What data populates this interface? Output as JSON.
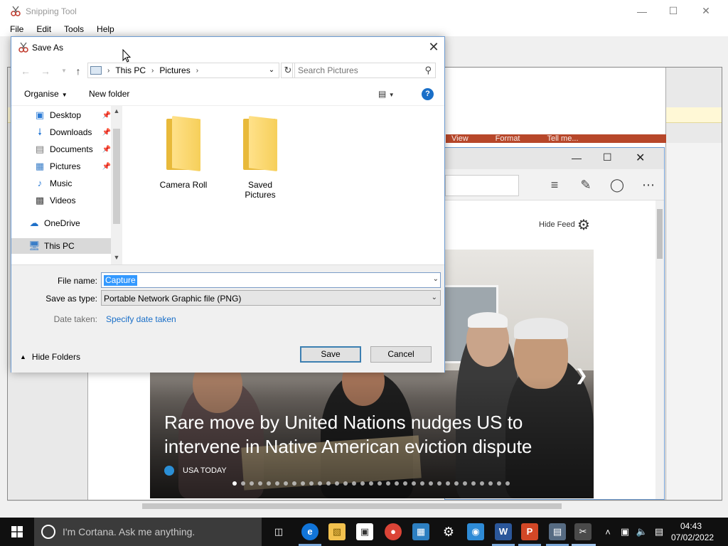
{
  "snipping_tool": {
    "title": "Snipping Tool",
    "menu": [
      "File",
      "Edit",
      "Tools",
      "Help"
    ]
  },
  "captured": {
    "ppt_tabs": [
      "View",
      "Format",
      "Tell me..."
    ],
    "edge": {
      "hide_feed": "Hide Feed"
    },
    "news": {
      "headline": "Rare move by United Nations nudges US to intervene in Native American eviction dispute",
      "source": "USA TODAY",
      "dot_count": 33,
      "active_dot": 0
    }
  },
  "dialog": {
    "title": "Save As",
    "breadcrumb": [
      "This PC",
      "Pictures"
    ],
    "search_placeholder": "Search Pictures",
    "organise": "Organise",
    "new_folder": "New folder",
    "nav_items": [
      {
        "label": "Desktop",
        "icon": "desktop-icon",
        "pinned": true
      },
      {
        "label": "Downloads",
        "icon": "download-icon",
        "pinned": true
      },
      {
        "label": "Documents",
        "icon": "documents-icon",
        "pinned": true
      },
      {
        "label": "Pictures",
        "icon": "pictures-icon",
        "pinned": true
      },
      {
        "label": "Music",
        "icon": "music-icon",
        "pinned": false
      },
      {
        "label": "Videos",
        "icon": "videos-icon",
        "pinned": false
      },
      {
        "label": "OneDrive",
        "icon": "onedrive-icon",
        "pinned": false
      },
      {
        "label": "This PC",
        "icon": "pc-icon",
        "pinned": false,
        "selected": true
      }
    ],
    "folders": [
      "Camera Roll",
      "Saved Pictures"
    ],
    "file_name_label": "File name:",
    "file_name_value": "Capture",
    "save_type_label": "Save as type:",
    "save_type_value": "Portable Network Graphic file (PNG)",
    "date_taken_label": "Date taken:",
    "date_taken_link": "Specify date taken",
    "hide_folders": "Hide Folders",
    "save": "Save",
    "cancel": "Cancel"
  },
  "taskbar": {
    "cortana": "I'm Cortana. Ask me anything.",
    "time": "04:43",
    "date": "07/02/2022"
  }
}
